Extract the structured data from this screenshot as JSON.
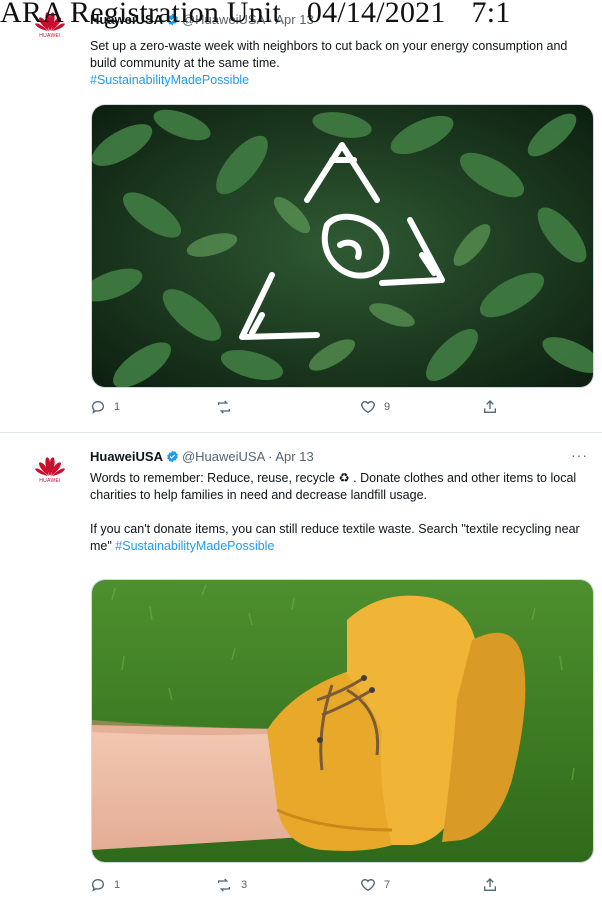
{
  "stamp": {
    "left_text": "ARA Registration Unit",
    "date": "04/14/2021",
    "time": "7:1"
  },
  "brand": {
    "logo_text": "HUAWEI",
    "accent": "#c8102e",
    "link_color": "#1d9bf0"
  },
  "tweets": [
    {
      "author": "HuaweiUSA",
      "handle": "@HuaweiUSA",
      "date": "Apr 13",
      "text": [
        "Set up a zero-waste week with neighbors to cut back on your energy consumption and build community at the same time."
      ],
      "hashtag": "#SustainabilityMadePossible",
      "media": "leaves-with-recycle-symbol",
      "replies": "1",
      "retweets": "",
      "likes": "9"
    },
    {
      "author": "HuaweiUSA",
      "handle": "@HuaweiUSA · Apr 13",
      "more": "···",
      "text": [
        "Words to remember: Reduce, reuse, recycle ♻ . Donate clothes and other items to local charities to help families in need and decrease landfill usage.",
        "If you can't donate items, you can still reduce textile waste. Search \"textile recycling near me\""
      ],
      "hashtag": "#SustainabilityMadePossible",
      "media": "yellow-sneakers-on-grass",
      "replies": "1",
      "retweets": "3",
      "likes": "7"
    }
  ]
}
